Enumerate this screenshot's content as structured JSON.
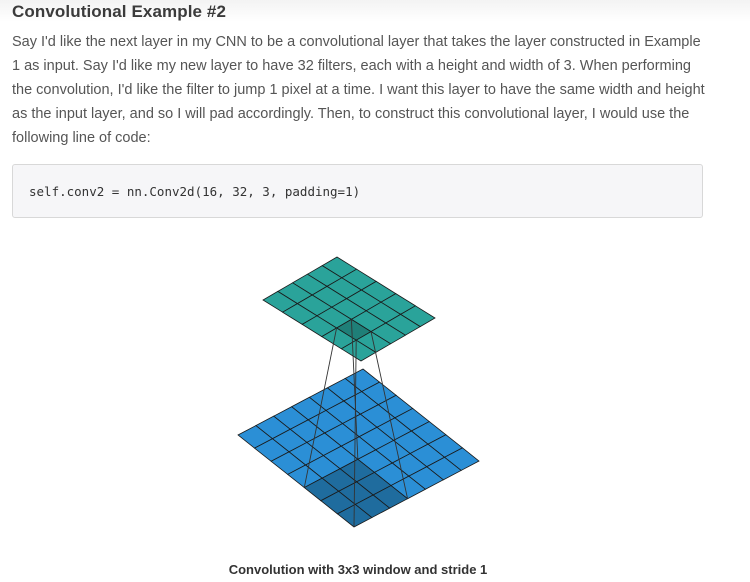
{
  "heading": "Convolutional Example #2",
  "paragraph": "Say I'd like the next layer in my CNN to be a convolutional layer that takes the layer constructed in Example 1 as input. Say I'd like my new layer to have 32 filters, each with a height and width of 3. When performing the convolution, I'd like the filter to jump 1 pixel at a time. I want this layer to have the same width and height as the input layer, and so I will pad accordingly. Then, to construct this convolutional layer, I would use the following line of code:",
  "code": "self.conv2 = nn.Conv2d(16, 32, 3, padding=1)",
  "figure": {
    "caption": "Convolution with 3x3 window and stride 1",
    "input_grid_size": 7,
    "output_grid_size": 5,
    "window_size": 3,
    "colors": {
      "input": "#2b8fd6",
      "input_highlight": "#1f6c9e",
      "output": "#2aa39a",
      "output_highlight": "#1f7f78",
      "grid_line": "#1a1a1a"
    }
  }
}
